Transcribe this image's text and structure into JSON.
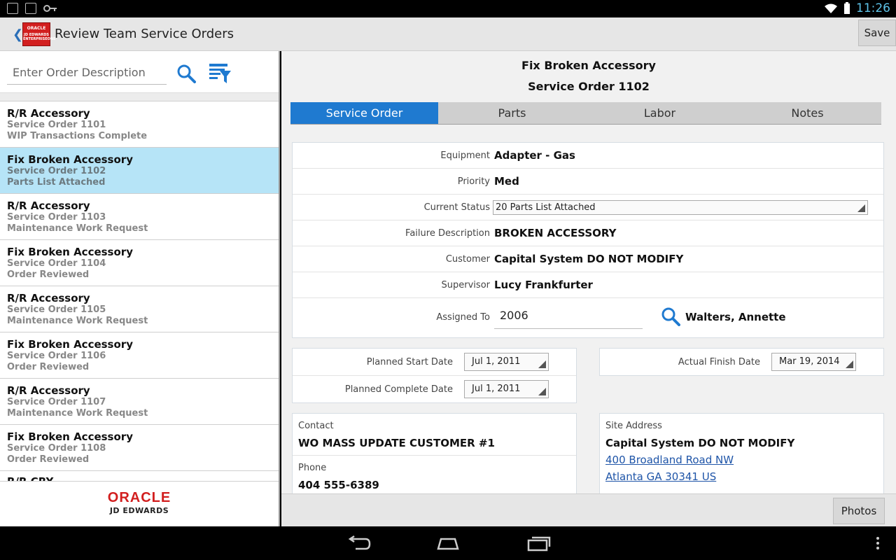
{
  "status_bar": {
    "time": "11:26",
    "icons": [
      "download-icon",
      "image-icon",
      "key-icon",
      "wifi-icon",
      "battery-icon"
    ]
  },
  "action_bar": {
    "title": "Review Team Service Orders",
    "logo_line1": "ORACLE",
    "logo_line2": "JD EDWARDS ENTERPRISEONE",
    "save_label": "Save"
  },
  "search": {
    "placeholder": "Enter Order Description"
  },
  "orders": [
    {
      "title": "R/R Accessory",
      "number": "Service Order 1101",
      "status": "WIP Transactions Complete",
      "selected": false
    },
    {
      "title": "Fix Broken Accessory",
      "number": "Service Order 1102",
      "status": "Parts List Attached",
      "selected": true
    },
    {
      "title": "R/R Accessory",
      "number": "Service Order 1103",
      "status": "Maintenance Work Request",
      "selected": false
    },
    {
      "title": "Fix Broken Accessory",
      "number": "Service Order 1104",
      "status": "Order Reviewed",
      "selected": false
    },
    {
      "title": "R/R Accessory",
      "number": "Service Order 1105",
      "status": "Maintenance Work Request",
      "selected": false
    },
    {
      "title": "Fix Broken Accessory",
      "number": "Service Order 1106",
      "status": "Order Reviewed",
      "selected": false
    },
    {
      "title": "R/R Accessory",
      "number": "Service Order 1107",
      "status": "Maintenance Work Request",
      "selected": false
    },
    {
      "title": "Fix Broken Accessory",
      "number": "Service Order 1108",
      "status": "Order Reviewed",
      "selected": false
    }
  ],
  "partial_order_title": "R/R CRY",
  "footer": {
    "oracle": "ORACLE",
    "jde": "JD EDWARDS"
  },
  "detail": {
    "title": "Fix Broken Accessory",
    "order_number": "Service Order 1102",
    "tabs": [
      "Service Order",
      "Parts",
      "Labor",
      "Notes"
    ],
    "active_tab": 0,
    "fields": {
      "equipment_label": "Equipment",
      "equipment": "Adapter - Gas",
      "priority_label": "Priority",
      "priority": "Med",
      "status_label": "Current Status",
      "status": "20 Parts List Attached",
      "failure_label": "Failure Description",
      "failure": "BROKEN ACCESSORY",
      "customer_label": "Customer",
      "customer": "Capital System DO NOT MODIFY",
      "supervisor_label": "Supervisor",
      "supervisor": "Lucy Frankfurter",
      "assigned_label": "Assigned To",
      "assigned_id": "2006",
      "assigned_name": "Walters, Annette"
    },
    "dates": {
      "planned_start_label": "Planned Start Date",
      "planned_start": "Jul 1, 2011",
      "planned_complete_label": "Planned Complete Date",
      "planned_complete": "Jul 1, 2011",
      "actual_finish_label": "Actual Finish Date",
      "actual_finish": "Mar 19, 2014"
    },
    "contact": {
      "contact_label": "Contact",
      "contact": "WO MASS UPDATE CUSTOMER #1",
      "phone_label": "Phone",
      "phone": "404 555-6389"
    },
    "site": {
      "label": "Site Address",
      "name": "Capital System DO NOT MODIFY",
      "street": "400 Broadland Road NW",
      "city": "Atlanta GA 30341 US"
    }
  },
  "bottom_bar": {
    "photos_label": "Photos"
  },
  "colors": {
    "accent": "#1f7ad0",
    "selected_row": "#b6e4f7",
    "brand_red": "#d21f1f",
    "link": "#1f55a8"
  }
}
